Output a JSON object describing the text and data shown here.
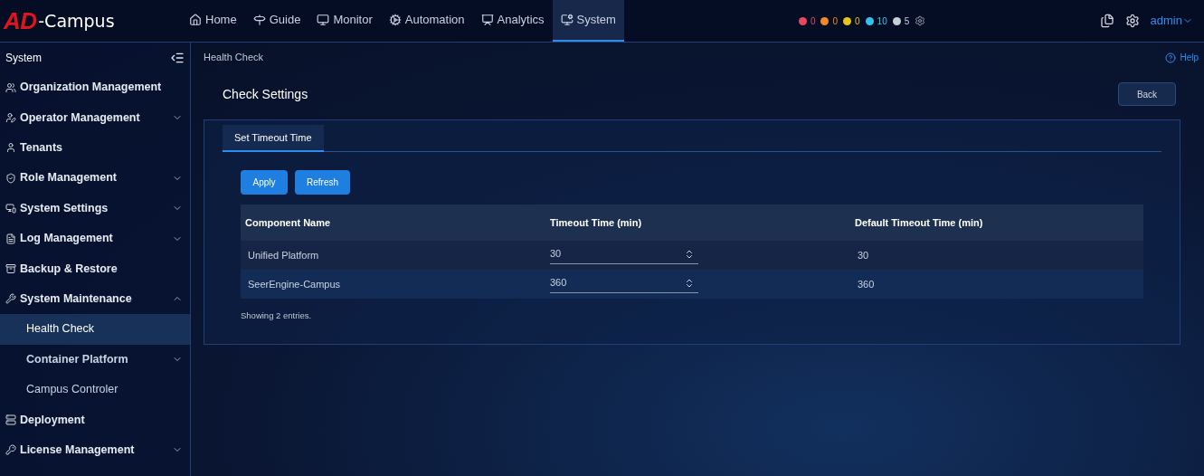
{
  "header": {
    "logo": {
      "mark": "AD",
      "name": "-Campus"
    },
    "nav": [
      {
        "label": "Home",
        "selected": false
      },
      {
        "label": "Guide",
        "selected": false
      },
      {
        "label": "Monitor",
        "selected": false
      },
      {
        "label": "Automation",
        "selected": false
      },
      {
        "label": "Analytics",
        "selected": false
      },
      {
        "label": "System",
        "selected": true
      }
    ],
    "alarms": [
      {
        "count": "0",
        "color": "#e8475f"
      },
      {
        "count": "0",
        "color": "#f08a24"
      },
      {
        "count": "0",
        "color": "#e6c619"
      },
      {
        "count": "10",
        "color": "#33c3e8"
      },
      {
        "count": "5",
        "color": "#c8ced6"
      }
    ],
    "user": "admin"
  },
  "sidebar": {
    "title": "System",
    "items": [
      {
        "label": "Organization Management"
      },
      {
        "label": "Operator Management",
        "expanded": false
      },
      {
        "label": "Tenants"
      },
      {
        "label": "Role Management",
        "expanded": false
      },
      {
        "label": "System Settings",
        "expanded": false
      },
      {
        "label": "Log Management",
        "expanded": false
      },
      {
        "label": "Backup & Restore"
      },
      {
        "label": "System Maintenance",
        "expanded": true,
        "children": [
          {
            "label": "Health Check",
            "selected": true
          },
          {
            "label": "Container Platform",
            "selected": false,
            "expanded": false
          },
          {
            "label": "Campus Controler",
            "selected": false
          }
        ]
      },
      {
        "label": "Deployment"
      },
      {
        "label": "License Management",
        "expanded": false
      }
    ]
  },
  "breadcrumb": "Health Check",
  "help": "Help",
  "page_title": "Check Settings",
  "back_button": "Back",
  "tabs": [
    {
      "label": "Set Timeout Time",
      "selected": true
    }
  ],
  "buttons": [
    "Apply",
    "Refresh"
  ],
  "table": {
    "columns": [
      "Component Name",
      "Timeout Time (min)",
      "Default Timeout Time (min)"
    ],
    "rows": [
      {
        "name": "Unified Platform",
        "timeout": "30",
        "default": "30",
        "selected": false
      },
      {
        "name": "SeerEngine-Campus",
        "timeout": "360",
        "default": "360",
        "selected": true
      }
    ]
  },
  "footer": "Showing 2 entries."
}
